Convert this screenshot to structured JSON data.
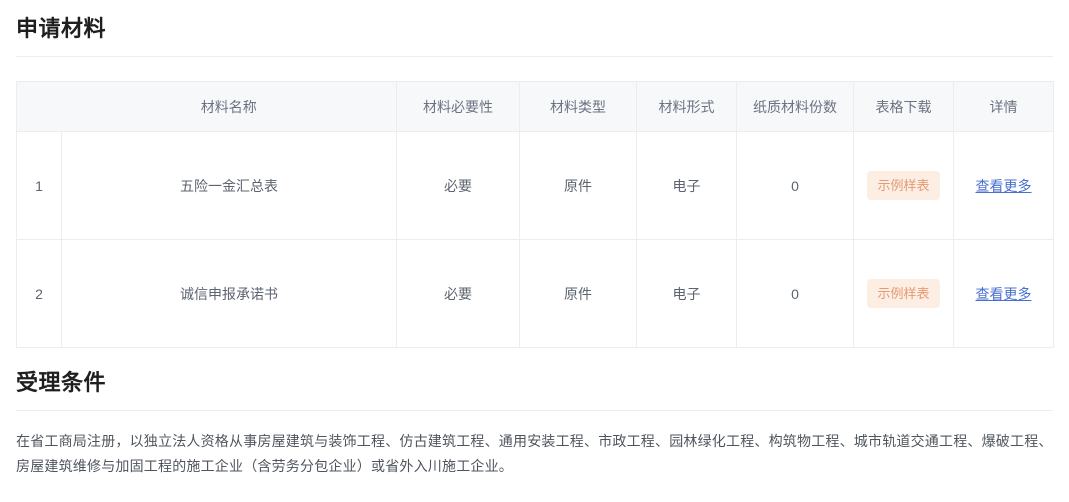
{
  "sections": {
    "materials": {
      "title": "申请材料"
    },
    "conditions": {
      "title": "受理条件",
      "paragraph": "在省工商局注册，以独立法人资格从事房屋建筑与装饰工程、仿古建筑工程、通用安装工程、市政工程、园林绿化工程、构筑物工程、城市轨道交通工程、爆破工程、房屋建筑维修与加固工程的施工企业（含劳务分包企业）或省外入川施工企业。"
    }
  },
  "table": {
    "headers": {
      "index": "",
      "name": "材料名称",
      "necessity": "材料必要性",
      "type": "材料类型",
      "form": "材料形式",
      "paper_count": "纸质材料份数",
      "download": "表格下载",
      "detail": "详情"
    },
    "rows": [
      {
        "index": "1",
        "name": "五险一金汇总表",
        "necessity": "必要",
        "type": "原件",
        "form": "电子",
        "paper_count": "0",
        "download_label": "示例样表",
        "detail_label": "查看更多"
      },
      {
        "index": "2",
        "name": "诚信申报承诺书",
        "necessity": "必要",
        "type": "原件",
        "form": "电子",
        "paper_count": "0",
        "download_label": "示例样表",
        "detail_label": "查看更多"
      }
    ]
  },
  "colors": {
    "header_bg": "#f7f8fa",
    "border": "#ebedf0",
    "badge_bg": "#fdeee4",
    "badge_text": "#e49a73",
    "link": "#4a6fd0",
    "title_text": "#1f1f1f",
    "body_text": "#4f555e"
  }
}
